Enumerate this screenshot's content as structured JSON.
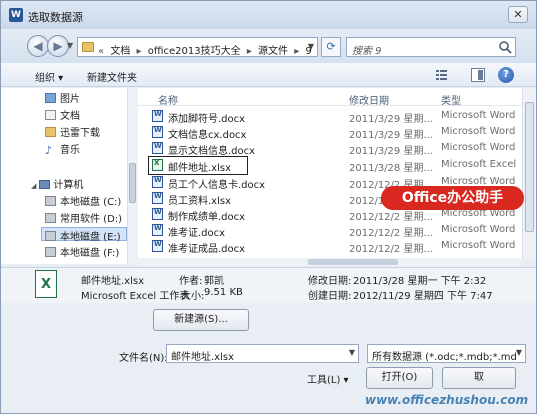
{
  "window": {
    "title": "选取数据源",
    "app_icon": "W"
  },
  "nav": {
    "breadcrumbs": [
      "文档",
      "office2013技巧大全",
      "源文件",
      "9"
    ],
    "search_placeholder": "搜索 9"
  },
  "toolbar": {
    "organize": "组织",
    "new_folder": "新建文件夹"
  },
  "sidebar": {
    "items": [
      {
        "label": "图片"
      },
      {
        "label": "文档"
      },
      {
        "label": "迅雷下载"
      },
      {
        "label": "音乐"
      }
    ],
    "computer": "计算机",
    "drives": [
      {
        "label": "本地磁盘 (C:)"
      },
      {
        "label": "常用软件 (D:)"
      },
      {
        "label": "本地磁盘 (E:)"
      },
      {
        "label": "本地磁盘 (F:)"
      }
    ]
  },
  "filelist": {
    "headers": {
      "name": "名称",
      "modified": "修改日期",
      "type": "类型"
    },
    "rows": [
      {
        "name": "添加脚符号.docx",
        "date": "2011/3/29 星期...",
        "type": "Microsoft Word",
        "kind": "word"
      },
      {
        "name": "文档信息cx.docx",
        "date": "2011/3/29 星期...",
        "type": "Microsoft Word",
        "kind": "word"
      },
      {
        "name": "显示文档信息.docx",
        "date": "2011/3/29 星期...",
        "type": "Microsoft Word",
        "kind": "word"
      },
      {
        "name": "邮件地址.xlsx",
        "date": "2011/3/28 星期...",
        "type": "Microsoft Excel",
        "kind": "excel"
      },
      {
        "name": "员工个人信息卡.docx",
        "date": "2012/12/2 星期...",
        "type": "Microsoft Word",
        "kind": "word"
      },
      {
        "name": "员工资料.xlsx",
        "date": "2012/12/2 星期...",
        "type": "Microsoft Word",
        "kind": "word"
      },
      {
        "name": "制作成绩单.docx",
        "date": "2012/12/2 星期...",
        "type": "Microsoft Word",
        "kind": "word"
      },
      {
        "name": "准考证.docx",
        "date": "2012/12/2 星期...",
        "type": "Microsoft Word",
        "kind": "word"
      },
      {
        "name": "准考证成品.docx",
        "date": "2012/12/2 星期...",
        "type": "Microsoft Word",
        "kind": "word"
      }
    ]
  },
  "badge": "Office办公助手",
  "details": {
    "filename": "邮件地址.xlsx",
    "filetype": "Microsoft Excel 工作表",
    "author_label": "作者:",
    "author": "郭凯",
    "size_label": "大小:",
    "size": "9.51 KB",
    "modified_label": "修改日期:",
    "modified": "2011/3/28 星期一 下午 2:32",
    "created_label": "创建日期:",
    "created": "2012/11/29 星期四 下午 7:47"
  },
  "bottom": {
    "new_source": "新建源(S)...",
    "filename_label": "文件名(N):",
    "filename_value": "邮件地址.xlsx",
    "filetype_value": "所有数据源 (*.odc;*.mdb;*.md",
    "tools": "工具(L)",
    "open": "打开(O)",
    "cancel": "取"
  },
  "watermark": "www.officezhushou.com"
}
